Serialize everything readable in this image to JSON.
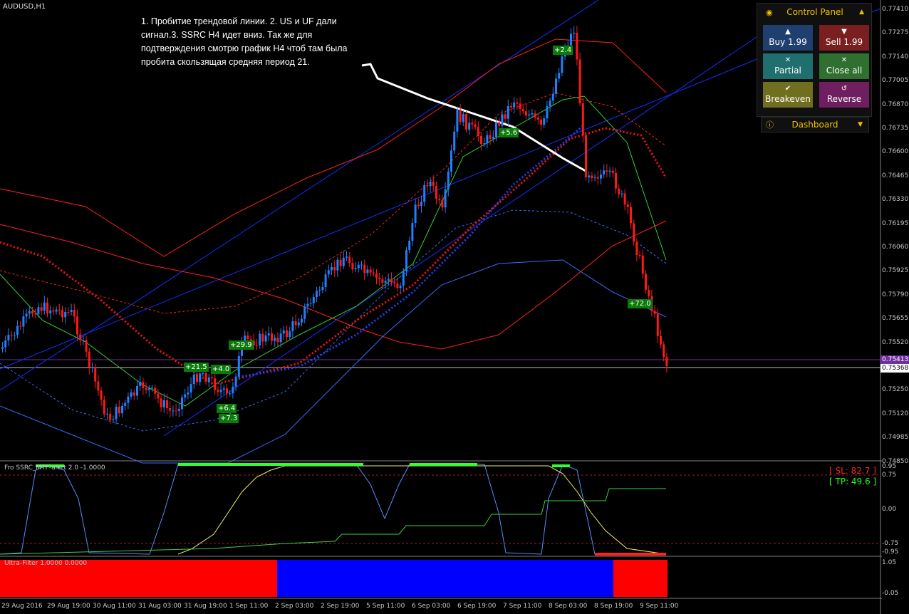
{
  "symbol": "AUDUSD,H1",
  "annotation": "1. Пробитие трендовой линии. 2. US и UF дали сигнал.3. SSRC H4 идет вниз. Так же для подтверждения смотрю график H4 чтоб там была пробита скользящая средняя период 21.",
  "price_axis": [
    "0.77410",
    "0.77275",
    "0.77140",
    "0.77005",
    "0.76870",
    "0.76735",
    "0.76600",
    "0.76465",
    "0.76330",
    "0.76195",
    "0.76060",
    "0.75925",
    "0.75790",
    "0.75655",
    "0.75520",
    "0.75385",
    "0.75250",
    "0.75120",
    "0.74985",
    "0.74850"
  ],
  "price_tags": {
    "upper": "0.75413",
    "current": "0.75368"
  },
  "time_axis": [
    "29 Aug 2016",
    "29 Aug 19:00",
    "30 Aug 11:00",
    "31 Aug 03:00",
    "31 Aug 19:00",
    "1 Sep 11:00",
    "2 Sep 03:00",
    "2 Sep 19:00",
    "5 Sep 11:00",
    "6 Sep 03:00",
    "6 Sep 19:00",
    "7 Sep 11:00",
    "8 Sep 03:00",
    "8 Sep 19:00",
    "9 Sep 11:00"
  ],
  "trade_labels": [
    "+21.5",
    "+4.0",
    "+29.9",
    "+6.4",
    "+7.3",
    "+2.4",
    "+5.6",
    "+72.0"
  ],
  "indicator1": {
    "title": "Fro SSRC_MTF-alert 2.0 -1.0000",
    "sl": "[ SL: 82.7 ]",
    "tp": "[ TP: 49.6 ]",
    "axis": [
      "0.95",
      "0.75",
      "0.00",
      "-0.75",
      "-0.95"
    ]
  },
  "indicator2": {
    "title": "Ultra-Filter 1.0000 0.0000",
    "axis": [
      "1.05",
      "-0.05"
    ]
  },
  "control_panel": {
    "title": "Control Panel",
    "buy": "Buy 1.99",
    "sell": "Sell 1.99",
    "partial": "Partial",
    "close_all": "Close all",
    "breakeven": "Breakeven",
    "reverse": "Reverse",
    "dashboard": "Dashboard"
  },
  "colors": {
    "up": "#1e90ff",
    "down": "#ff1e1e",
    "panel_accent": "#f0c000"
  }
}
